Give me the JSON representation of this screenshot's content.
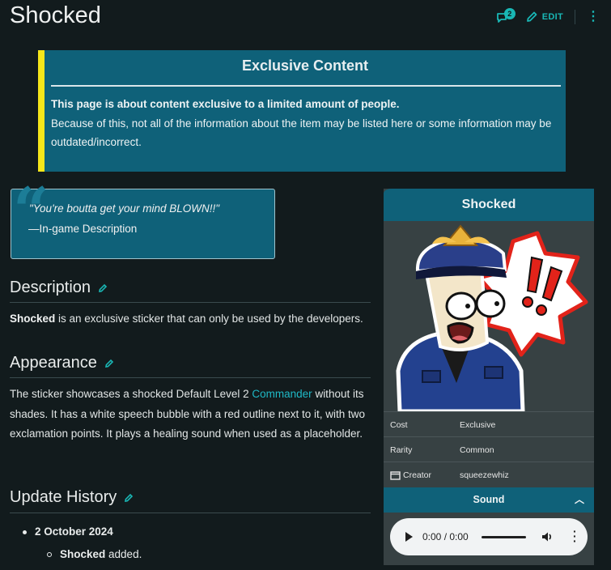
{
  "page": {
    "title": "Shocked",
    "comment_count": "2",
    "edit_label": "EDIT"
  },
  "notice": {
    "title": "Exclusive Content",
    "bold_line": "This page is about content exclusive to a limited amount of people.",
    "body": "Because of this, not all of the information about the item may be listed here or some information may be outdated/incorrect."
  },
  "quote": {
    "text": "\"You're boutta get your mind BLOWN!!\"",
    "source": "—In-game Description"
  },
  "sections": {
    "description": {
      "heading": "Description",
      "bold": "Shocked",
      "text": " is an exclusive sticker that can only be used by the developers."
    },
    "appearance": {
      "heading": "Appearance",
      "text_a": "The sticker showcases a shocked Default Level 2 ",
      "link": "Commander",
      "text_b": " without its shades. It has a white speech bubble with a red outline next to it, with two exclamation points. It plays a healing sound when used as a placeholder."
    },
    "update_history": {
      "heading": "Update History",
      "date": "2 October 2024",
      "item_bold": "Shocked",
      "item_text": " added."
    }
  },
  "infobox": {
    "title": "Shocked",
    "rows": [
      {
        "key": "Cost",
        "value": "Exclusive"
      },
      {
        "key": "Rarity",
        "value": "Common"
      },
      {
        "key": "Creator",
        "value": "squeezewhiz",
        "icon": "creator-icon"
      }
    ],
    "sound_label": "Sound",
    "player": {
      "time": "0:00 / 0:00"
    }
  },
  "colors": {
    "background": "#121b1d",
    "accent": "#19b7b5",
    "panel": "#0f6179",
    "notice_stripe": "#f5e61a",
    "infobox_bg": "#374143"
  }
}
